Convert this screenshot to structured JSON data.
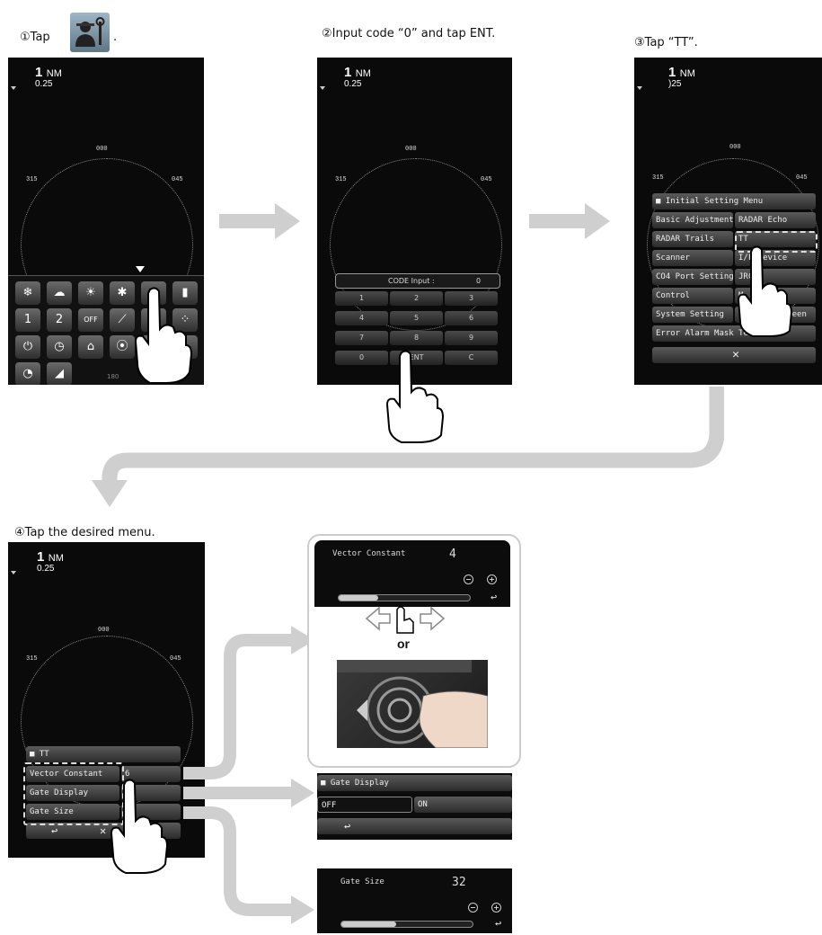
{
  "steps": {
    "s1": {
      "prefix": "①Tap",
      "suffix": "."
    },
    "s2": {
      "text": "②Input code “0” and tap ENT."
    },
    "s3": {
      "text": "③Tap “TT”."
    },
    "s4": {
      "text": "④Tap the desired menu."
    }
  },
  "screen": {
    "range": "1",
    "unit": "NM",
    "ring": "0.25",
    "ring_s3": ")25",
    "b000": "000",
    "b315": "315",
    "b045": "045"
  },
  "icons": [
    {
      "name": "weather-icon",
      "glyph": "❄"
    },
    {
      "name": "rain-icon",
      "glyph": "☁"
    },
    {
      "name": "brightness-icon",
      "glyph": "☀"
    },
    {
      "name": "color-icon",
      "glyph": "✱"
    },
    {
      "name": "tools-icon",
      "glyph": "⚙"
    },
    {
      "name": "book-icon",
      "glyph": "▮"
    },
    {
      "name": "user1-icon",
      "glyph": "1"
    },
    {
      "name": "user2-icon",
      "glyph": "2"
    },
    {
      "name": "off-icon",
      "glyph": "OFF"
    },
    {
      "name": "ebl-icon",
      "glyph": "⟋"
    },
    {
      "name": "blank-icon-1",
      "glyph": ""
    },
    {
      "name": "dots-icon",
      "glyph": "⁘"
    },
    {
      "name": "alarm-icon",
      "glyph": "⏻"
    },
    {
      "name": "timer-icon",
      "glyph": "◷"
    },
    {
      "name": "antenna-icon",
      "glyph": "⌂"
    },
    {
      "name": "location-icon",
      "glyph": "⦿"
    },
    {
      "name": "blank-icon-2",
      "glyph": ""
    },
    {
      "name": "blank-icon-3",
      "glyph": ""
    },
    {
      "name": "radar-icon",
      "glyph": "◔"
    },
    {
      "name": "curve-icon",
      "glyph": "◢"
    }
  ],
  "icon_label_180": "180",
  "code": {
    "label": "CODE Input :",
    "value": "0",
    "keys": [
      "1",
      "2",
      "3",
      "4",
      "5",
      "6",
      "7",
      "8",
      "9",
      "0",
      "ENT",
      "C"
    ]
  },
  "menu3": {
    "title": "■ Initial Setting Menu",
    "rows": [
      {
        "left": "Basic Adjustment",
        "right": "RADAR Echo"
      },
      {
        "left": "RADAR Trails",
        "right": "TT"
      },
      {
        "left": "Scanner",
        "right": "I/F Device"
      },
      {
        "left": "CO4 Port Setting",
        "right": "JRC"
      },
      {
        "left": "Control",
        "right": "M"
      },
      {
        "left": "System Setting",
        "right": "Display Screen"
      },
      {
        "left": "Error Alarm Mask Test",
        "right": ""
      }
    ],
    "close": "✕"
  },
  "menu4": {
    "title": "■ TT",
    "rows": [
      {
        "left": "Vector Constant",
        "right": "6"
      },
      {
        "left": "Gate Display",
        "right": ""
      },
      {
        "left": "Gate Size",
        "right": ""
      }
    ],
    "back": "↩",
    "close": "✕"
  },
  "panel_vector": {
    "label": "Vector Constant",
    "value": "4",
    "level": 0.3,
    "back": "↩"
  },
  "or": "or",
  "panel_gate": {
    "title": "■ Gate Display",
    "off": "OFF",
    "on": "ON",
    "back": "↩"
  },
  "panel_size": {
    "label": "Gate Size",
    "value": "32",
    "level": 0.42,
    "back": "↩"
  },
  "colors": {
    "arrow": "#cfcfcf",
    "screen": "#0a0a0a"
  }
}
